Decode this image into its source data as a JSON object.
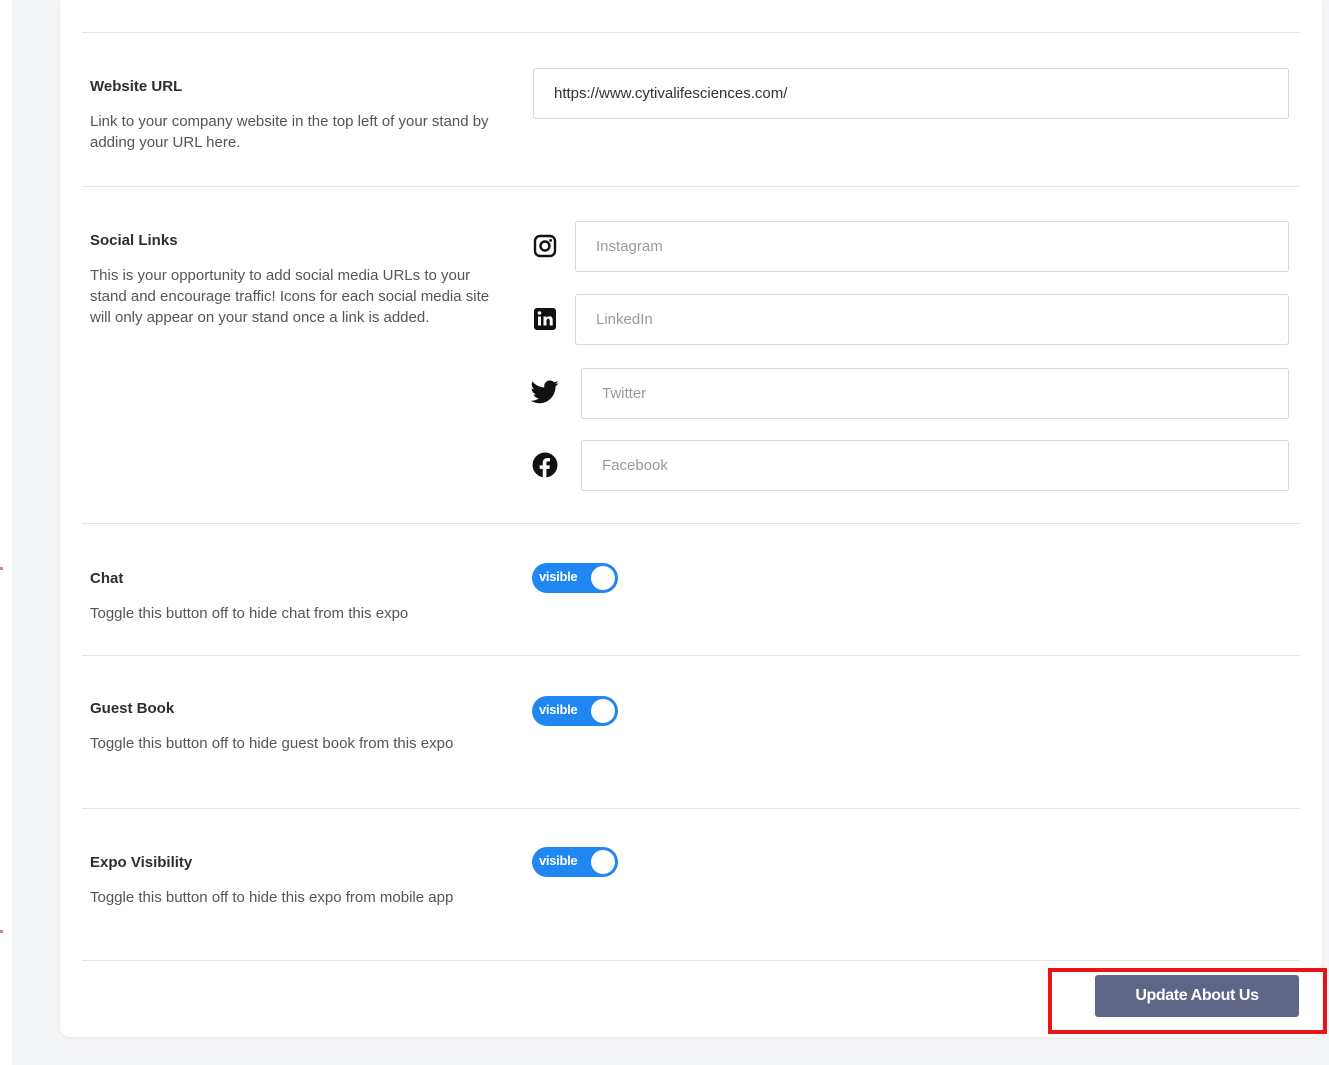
{
  "website": {
    "label": "Website URL",
    "description": "Link to your company website in the top left of your stand by adding your URL here.",
    "value": "https://www.cytivalifesciences.com/"
  },
  "social": {
    "label": "Social Links",
    "description": "This is your opportunity to add social media URLs to your stand and encourage traffic! Icons for each social media site will only appear on your stand once a link is added.",
    "instagram_placeholder": "Instagram",
    "linkedin_placeholder": "LinkedIn",
    "twitter_placeholder": "Twitter",
    "facebook_placeholder": "Facebook",
    "icons": [
      "instagram-icon",
      "linkedin-icon",
      "twitter-icon",
      "facebook-icon"
    ]
  },
  "chat": {
    "label": "Chat",
    "description": "Toggle this button off to hide chat from this expo",
    "toggle_label": "visible",
    "on": true
  },
  "guestbook": {
    "label": "Guest Book",
    "description": "Toggle this button off to hide guest book from this expo",
    "toggle_label": "visible",
    "on": true
  },
  "expo_visibility": {
    "label": "Expo Visibility",
    "description": "Toggle this button off to hide this expo from mobile app",
    "toggle_label": "visible",
    "on": true
  },
  "actions": {
    "update_label": "Update About Us"
  },
  "colors": {
    "toggle_on": "#1f86f2",
    "button_bg": "#5e6587",
    "highlight": "#e8141a"
  }
}
